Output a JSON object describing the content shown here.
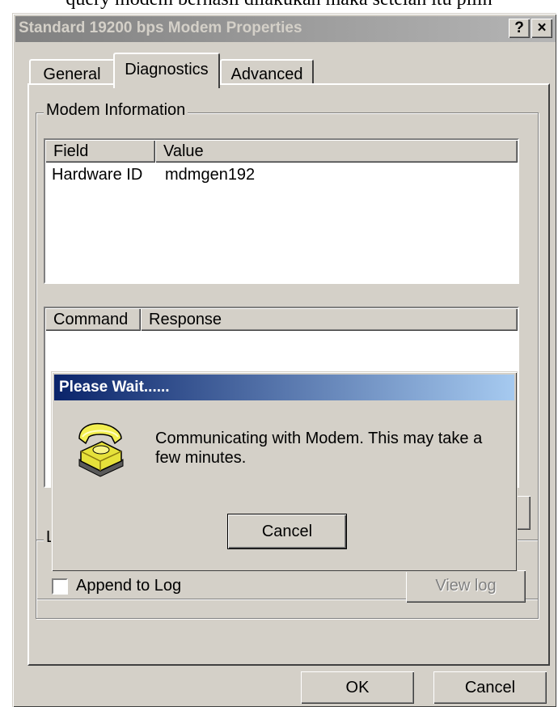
{
  "background_text": "query modem berhasil dilakukan maka setelah itu pilih",
  "window": {
    "title": "Standard 19200 bps Modem Properties",
    "help_button": "?",
    "close_button": "×"
  },
  "tabs": [
    {
      "label": "General",
      "active": false
    },
    {
      "label": "Diagnostics",
      "active": true
    },
    {
      "label": "Advanced",
      "active": false
    }
  ],
  "modem_info": {
    "group_label": "Modem Information",
    "columns": [
      "Field",
      "Value"
    ],
    "rows": [
      {
        "field": "Hardware ID",
        "value": "mdmgen192"
      }
    ]
  },
  "command_list": {
    "columns": [
      "Command",
      "Response"
    ]
  },
  "logging": {
    "group_label": "L",
    "append_label": "Append to Log",
    "append_checked": false,
    "view_log_label": "View log"
  },
  "footer": {
    "ok_label": "OK",
    "cancel_label": "Cancel"
  },
  "dialog": {
    "title": "Please Wait......",
    "message": "Communicating with Modem. This may take a few minutes.",
    "cancel_label": "Cancel",
    "icon": "telephone-icon"
  },
  "colors": {
    "face": "#d4d0c8",
    "dialog_title_start": "#0a246a",
    "dialog_title_end": "#a6caf0",
    "inactive_title": "#808080"
  }
}
